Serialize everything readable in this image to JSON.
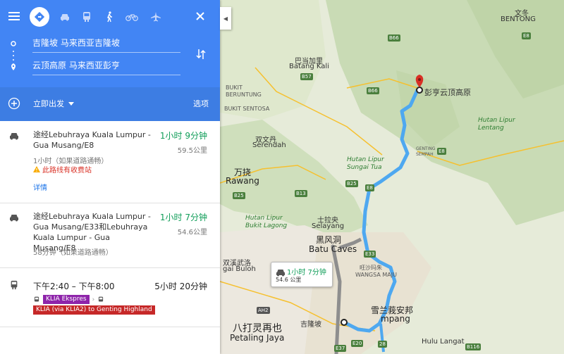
{
  "header": {
    "origin": "吉隆坡 马来西亚吉隆坡",
    "destination": "云顶高原 马来西亚彭亨",
    "depart_label": "立即出发",
    "options_label": "选项",
    "modes": [
      "drive-icon",
      "car-icon",
      "transit-icon",
      "walk-icon",
      "bike-icon",
      "flight-icon"
    ]
  },
  "routes": [
    {
      "via": "途经Lebuhraya Kuala Lumpur - Gua Musang/E8",
      "time": "1小时 9分钟",
      "distance": "59.5公里",
      "note": "1小时（如果道路通畅）",
      "warning": "此路线有收费站",
      "details": "详情"
    },
    {
      "via": "途经Lebuhraya Kuala Lumpur - Gua Musang/E33和Lebuhraya Kuala Lumpur - Gua Musang/E8",
      "time": "1小时 7分钟",
      "distance": "54.6公里",
      "note": "58分钟（如果道路通畅）"
    },
    {
      "schedule": "下午2:40 – 下午8:00",
      "time": "5小时 20分钟",
      "line1": "KLIA Ekspres",
      "line2": "KLIA (via KLIA2) to Genting Highland"
    }
  ],
  "map": {
    "tooltip_time": "1小时 7分钟",
    "tooltip_distance": "54.6 公里",
    "labels": {
      "bentong_cn": "文冬",
      "bentong": "BENTONG",
      "batang_kali_cn": "巴当加里",
      "batang_kali": "Batang Kali",
      "bukit_beruntung": "BUKIT\nBERUNTUNG",
      "bukit_sentosa": "BUKIT SENTOSA",
      "serendah_cn": "双文丹",
      "serendah": "Serendah",
      "rawang_cn": "万挠",
      "rawang": "Rawang",
      "destination_cn": "彭亨云顶高原",
      "genting_sempah": "GENTING\nSEMPAH",
      "hutan_lipur_lentang": "Hutan Lipur\nLentang",
      "hutan_lipur_sungai_tua": "Hutan Lipur\nSungai Tua",
      "hutan_lipur_bukit_lagong": "Hutan Lipur\nBukit Lagong",
      "selayang_cn": "士拉央",
      "selayang": "Selayang",
      "batu_caves_cn": "黑风洞",
      "batu_caves": "Batu Caves",
      "sungai_buloh_cn": "双溪武洛",
      "sungai_buloh": "gai Buloh",
      "wangsa_cn": "旺沙玛朱",
      "wangsa": "WANGSA MAJU",
      "ampang_cn": "雪兰莪安邦",
      "ampang": "mpang",
      "kl_cn": "吉隆坡",
      "petaling_cn": "八打灵再也",
      "petaling": "Petaling Jaya",
      "hulu_langat": "Hulu Langat"
    },
    "shields": [
      "E8",
      "B66",
      "B57",
      "B66",
      "B25",
      "E8",
      "B25",
      "B13",
      "E8",
      "AH2",
      "E20",
      "E37",
      "28",
      "B116",
      "E33"
    ]
  },
  "colors": {
    "header_blue": "#4285f4",
    "route_blue": "#4ea8f0",
    "alt_route_gray": "#8e8e8e",
    "time_green": "#0f9d58",
    "klia_badge": "#8e24aa",
    "genting_badge": "#c62828"
  }
}
